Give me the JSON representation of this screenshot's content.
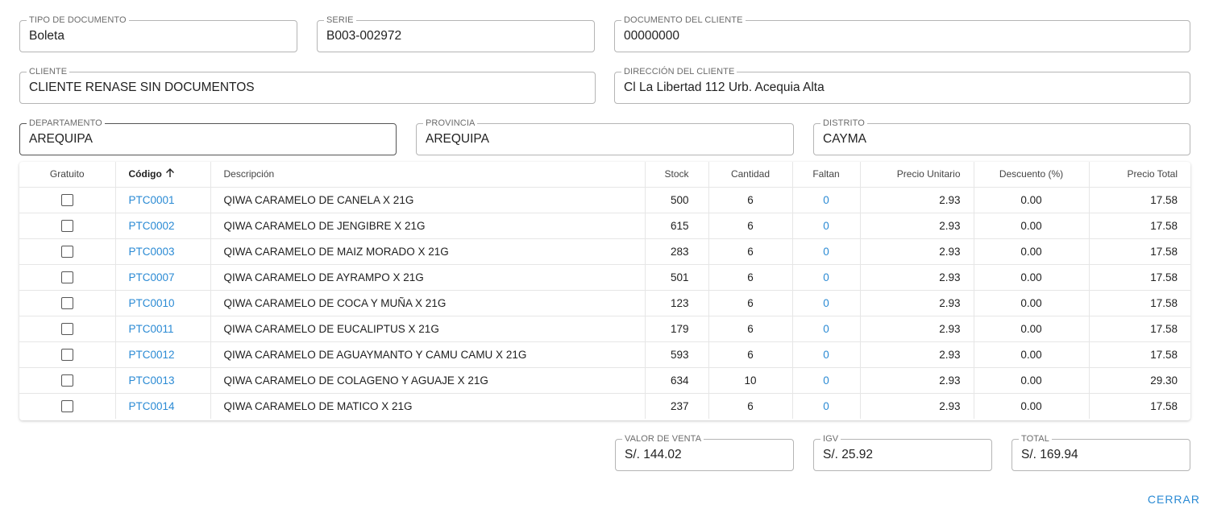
{
  "form": {
    "tipo_documento": {
      "label": "TIPO DE DOCUMENTO",
      "value": "Boleta"
    },
    "serie": {
      "label": "SERIE",
      "value": "B003-002972"
    },
    "documento_cliente": {
      "label": "DOCUMENTO DEL CLIENTE",
      "value": "00000000"
    },
    "cliente": {
      "label": "CLIENTE",
      "value": "CLIENTE RENASE SIN DOCUMENTOS"
    },
    "direccion": {
      "label": "DIRECCIÓN DEL CLIENTE",
      "value": "Cl La Libertad 112 Urb. Acequia Alta"
    },
    "departamento": {
      "label": "DEPARTAMENTO",
      "value": "AREQUIPA"
    },
    "provincia": {
      "label": "PROVINCIA",
      "value": "AREQUIPA"
    },
    "distrito": {
      "label": "DISTRITO",
      "value": "CAYMA"
    }
  },
  "table": {
    "columns": {
      "gratuito": "Gratuito",
      "codigo": "Código",
      "descripcion": "Descripción",
      "stock": "Stock",
      "cantidad": "Cantidad",
      "faltan": "Faltan",
      "precio_unitario": "Precio Unitario",
      "descuento": "Descuento (%)",
      "precio_total": "Precio Total"
    },
    "sort_icon": "arrow-up-icon",
    "rows": [
      {
        "codigo": "PTC0001",
        "descripcion": "QIWA CARAMELO DE CANELA X 21G",
        "stock": "500",
        "cantidad": "6",
        "faltan": "0",
        "precio_unitario": "2.93",
        "descuento": "0.00",
        "precio_total": "17.58"
      },
      {
        "codigo": "PTC0002",
        "descripcion": "QIWA CARAMELO DE JENGIBRE X 21G",
        "stock": "615",
        "cantidad": "6",
        "faltan": "0",
        "precio_unitario": "2.93",
        "descuento": "0.00",
        "precio_total": "17.58"
      },
      {
        "codigo": "PTC0003",
        "descripcion": "QIWA CARAMELO DE MAIZ MORADO X 21G",
        "stock": "283",
        "cantidad": "6",
        "faltan": "0",
        "precio_unitario": "2.93",
        "descuento": "0.00",
        "precio_total": "17.58"
      },
      {
        "codigo": "PTC0007",
        "descripcion": "QIWA CARAMELO DE AYRAMPO X 21G",
        "stock": "501",
        "cantidad": "6",
        "faltan": "0",
        "precio_unitario": "2.93",
        "descuento": "0.00",
        "precio_total": "17.58"
      },
      {
        "codigo": "PTC0010",
        "descripcion": "QIWA CARAMELO DE COCA Y MUÑA X 21G",
        "stock": "123",
        "cantidad": "6",
        "faltan": "0",
        "precio_unitario": "2.93",
        "descuento": "0.00",
        "precio_total": "17.58"
      },
      {
        "codigo": "PTC0011",
        "descripcion": "QIWA CARAMELO DE EUCALIPTUS X 21G",
        "stock": "179",
        "cantidad": "6",
        "faltan": "0",
        "precio_unitario": "2.93",
        "descuento": "0.00",
        "precio_total": "17.58"
      },
      {
        "codigo": "PTC0012",
        "descripcion": "QIWA CARAMELO DE AGUAYMANTO Y CAMU CAMU X 21G",
        "stock": "593",
        "cantidad": "6",
        "faltan": "0",
        "precio_unitario": "2.93",
        "descuento": "0.00",
        "precio_total": "17.58"
      },
      {
        "codigo": "PTC0013",
        "descripcion": "QIWA CARAMELO DE COLAGENO Y AGUAJE X 21G",
        "stock": "634",
        "cantidad": "10",
        "faltan": "0",
        "precio_unitario": "2.93",
        "descuento": "0.00",
        "precio_total": "29.30"
      },
      {
        "codigo": "PTC0014",
        "descripcion": "QIWA CARAMELO DE MATICO X 21G",
        "stock": "237",
        "cantidad": "6",
        "faltan": "0",
        "precio_unitario": "2.93",
        "descuento": "0.00",
        "precio_total": "17.58"
      }
    ]
  },
  "totals": {
    "valor_venta": {
      "label": "VALOR DE VENTA",
      "value": "S/. 144.02"
    },
    "igv": {
      "label": "IGV",
      "value": "S/. 25.92"
    },
    "total": {
      "label": "TOTAL",
      "value": "S/. 169.94"
    }
  },
  "actions": {
    "cerrar": "CERRAR"
  },
  "colors": {
    "accent": "#2a8ad4",
    "border": "#b5b5b5"
  }
}
